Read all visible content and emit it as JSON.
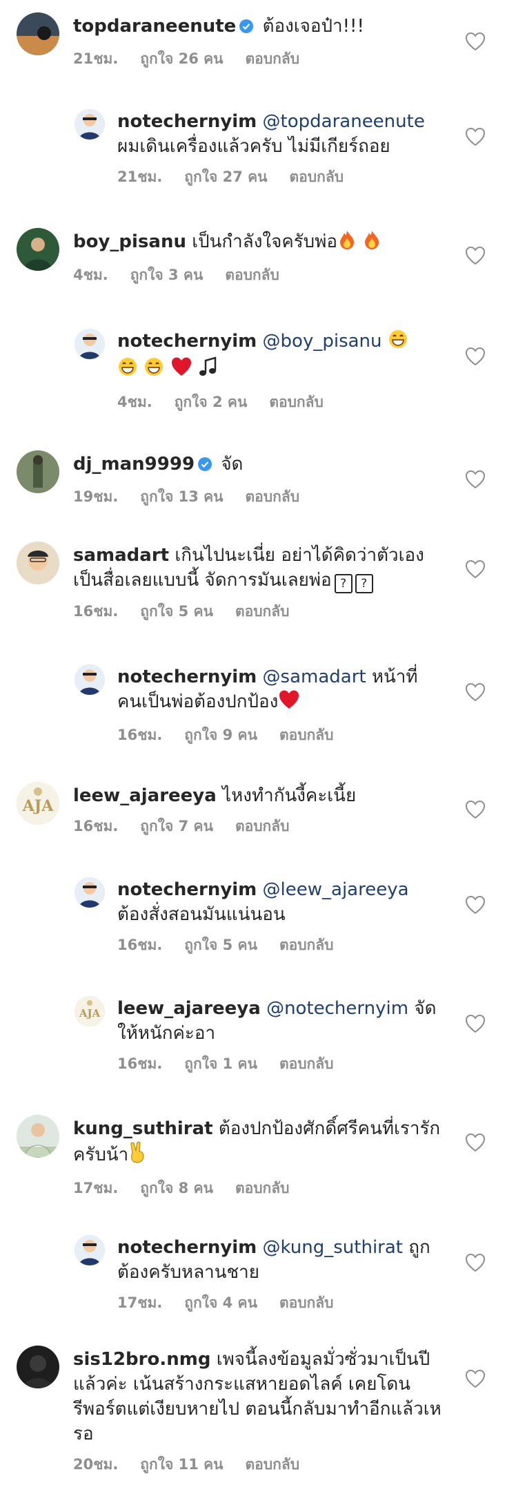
{
  "comments": [
    {
      "username": "topdaraneenute",
      "verified": true,
      "text": "ต้องเจอป๋า!!!",
      "time": "21ชม.",
      "likes": "ถูกใจ 26 คน",
      "reply": "ตอบกลับ"
    },
    {
      "username": "notechernyim",
      "verified": false,
      "mention": "@topdaraneenute",
      "text": "ผมเดินเครื่องแล้วครับ ไม่มีเกียร์ถอย",
      "time": "21ชม.",
      "likes": "ถูกใจ 27 คน",
      "reply": "ตอบกลับ"
    },
    {
      "username": "boy_pisanu",
      "verified": false,
      "text": "เป็นกำลังใจครับพ่อ",
      "time": "4ชม.",
      "likes": "ถูกใจ 3 คน",
      "reply": "ตอบกลับ"
    },
    {
      "username": "notechernyim",
      "verified": false,
      "mention": "@boy_pisanu",
      "text": "",
      "time": "4ชม.",
      "likes": "ถูกใจ 2 คน",
      "reply": "ตอบกลับ"
    },
    {
      "username": "dj_man9999",
      "verified": true,
      "text": "จัด",
      "time": "19ชม.",
      "likes": "ถูกใจ 13 คน",
      "reply": "ตอบกลับ"
    },
    {
      "username": "samadart",
      "verified": false,
      "text": "เกินไปนะเนี่ย อย่าได้คิดว่าตัวเองเป็นสื่อเลยแบบนี้ จัดการมันเลยพ่อ",
      "time": "16ชม.",
      "likes": "ถูกใจ 5 คน",
      "reply": "ตอบกลับ"
    },
    {
      "username": "notechernyim",
      "verified": false,
      "mention": "@samadart",
      "text": "หน้าที่คนเป็นพ่อต้องปกป้อง",
      "time": "16ชม.",
      "likes": "ถูกใจ 9 คน",
      "reply": "ตอบกลับ"
    },
    {
      "username": "leew_ajareeya",
      "verified": false,
      "text": "ไหงทำกันงี้คะเนี้ย",
      "time": "16ชม.",
      "likes": "ถูกใจ 7 คน",
      "reply": "ตอบกลับ"
    },
    {
      "username": "notechernyim",
      "verified": false,
      "mention": "@leew_ajareeya",
      "text": "ต้องสั่งสอนมันแน่นอน",
      "time": "16ชม.",
      "likes": "ถูกใจ 5 คน",
      "reply": "ตอบกลับ"
    },
    {
      "username": "leew_ajareeya",
      "verified": false,
      "mention": "@notechernyim",
      "text": "จัดให้หนักค่ะอา",
      "time": "16ชม.",
      "likes": "ถูกใจ 1 คน",
      "reply": "ตอบกลับ"
    },
    {
      "username": "kung_suthirat",
      "verified": false,
      "text": "ต้องปกป้องศักดิ์ศรีคนที่เรารักครับน้า",
      "time": "17ชม.",
      "likes": "ถูกใจ 8 คน",
      "reply": "ตอบกลับ"
    },
    {
      "username": "notechernyim",
      "verified": false,
      "mention": "@kung_suthirat",
      "text": "ถูกต้องครับหลานชาย",
      "time": "17ชม.",
      "likes": "ถูกใจ 4 คน",
      "reply": "ตอบกลับ"
    },
    {
      "username": "sis12bro.nmg",
      "verified": false,
      "text": "เพจนี้ลงข้อมูลมั่วซั่วมาเป็นปีแล้วค่ะ เน้นสร้างกระแสหายอดไลค์ เคยโดนรีพอร์ตแต่เงียบหายไป ตอนนี้กลับมาทำอีกแล้วเหรอ",
      "time": "20ชม.",
      "likes": "ถูกใจ 11 คน",
      "reply": "ตอบกลับ"
    }
  ],
  "colors": {
    "text": "#262626",
    "meta": "#8e8e8e",
    "mention": "#1f3f6e",
    "verified": "#3897f0",
    "heart_outline": "#8e8e8e"
  },
  "icons": {
    "verified": "verified-badge-icon",
    "like": "heart-outline-icon"
  }
}
